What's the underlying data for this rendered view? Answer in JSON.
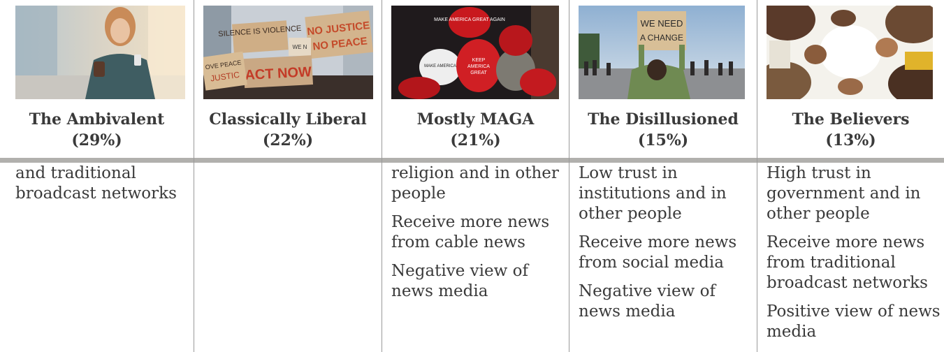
{
  "columns": [
    {
      "title": "The Ambivalent",
      "pct": "(29%)",
      "photo_alt": "woman with phone on city street",
      "lines": [
        "and traditional broadcast networks"
      ]
    },
    {
      "title": "Classically Liberal",
      "pct": "(22%)",
      "photo_alt": "protest signs",
      "protest_signs": [
        "SILENCE IS VIOLENCE",
        "NO JUSTICE NO PEACE",
        "ACT NOW",
        "WE N",
        "OVE PEACE JUSTICE"
      ],
      "lines": []
    },
    {
      "title": "Mostly MAGA",
      "pct": "(21%)",
      "photo_alt": "red campaign hats",
      "hat_text": [
        "MAKE AMERICA GREAT AGAIN",
        "KEEP AMERICA GREAT",
        "MAKE AMERICA GREAT",
        "MAKE AMERICA"
      ],
      "lines": [
        "religion and in other people",
        "Receive more news from cable news",
        "Negative view of news media"
      ]
    },
    {
      "title": "The Disillusioned",
      "pct": "(15%)",
      "photo_alt": "protester holding sign",
      "protest_signs": [
        "WE NEED A CHANGE"
      ],
      "lines": [
        "Low trust in institutions and in other people",
        "Receive more news from social media",
        "Negative view of news media"
      ]
    },
    {
      "title": "The Believers",
      "pct": "(13%)",
      "photo_alt": "hands joined in circle",
      "lines": [
        "High trust in government and in other people",
        "Receive more news from traditional broadcast networks",
        "Positive view of news media"
      ]
    }
  ]
}
